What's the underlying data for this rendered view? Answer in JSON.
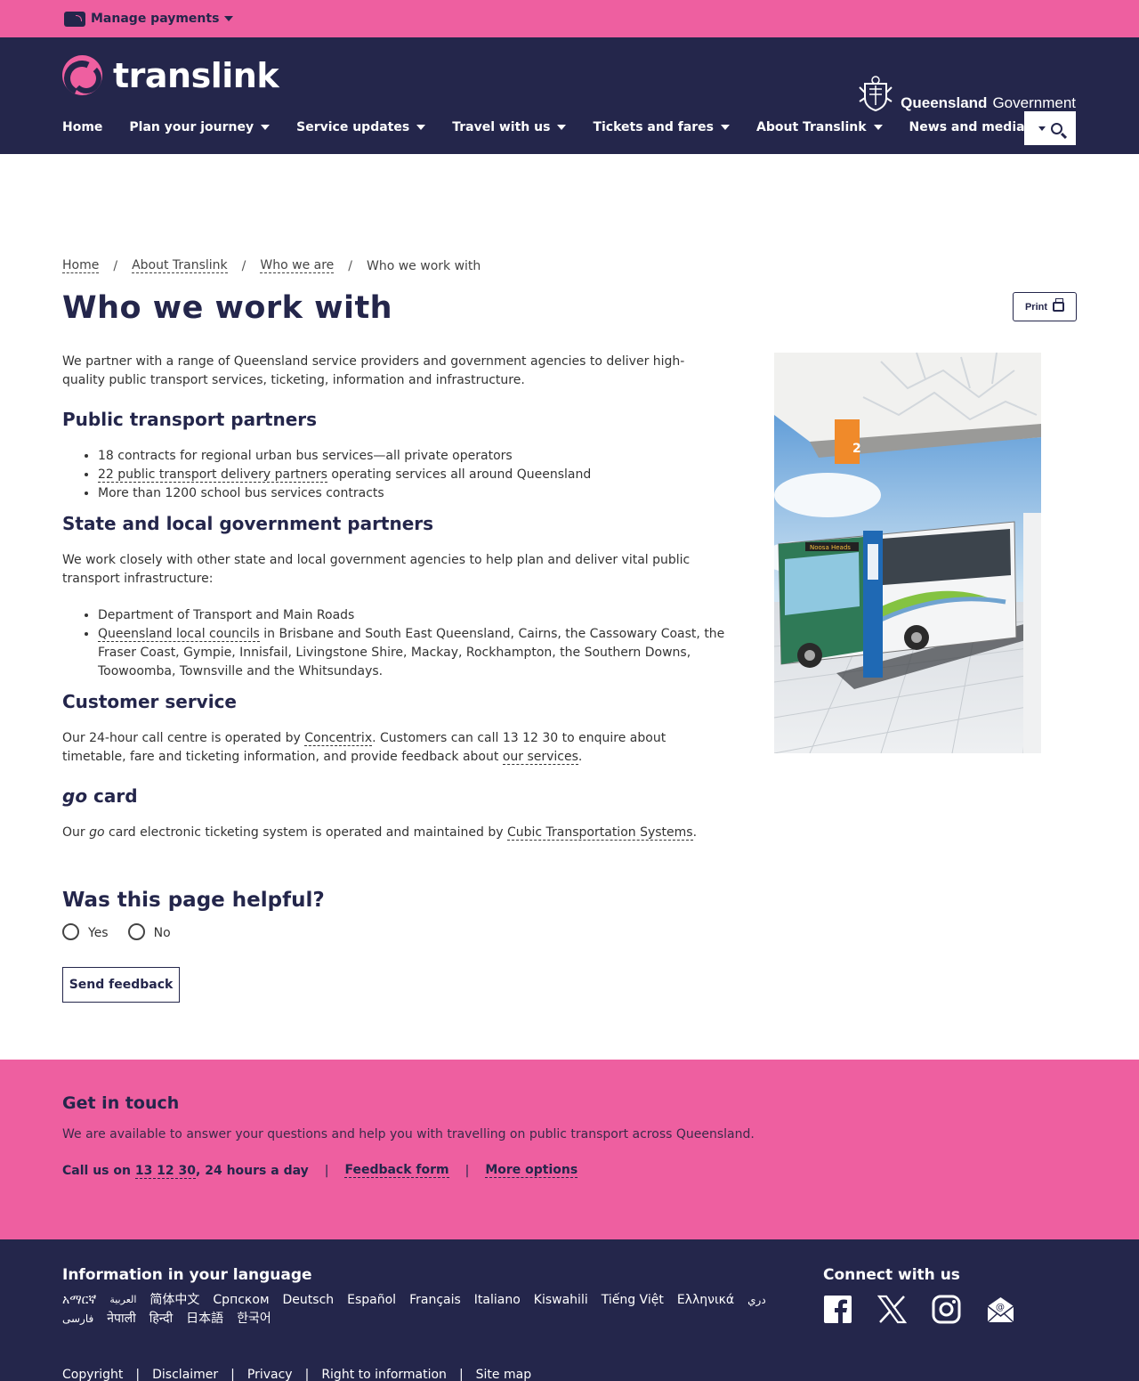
{
  "topbar": {
    "manage_payments": "Manage payments"
  },
  "header": {
    "logo_text": "translink",
    "qg_bold": "Queensland",
    "qg_rest": "Government"
  },
  "nav": [
    {
      "label": "Home",
      "dropdown": false
    },
    {
      "label": "Plan your journey",
      "dropdown": true
    },
    {
      "label": "Service updates",
      "dropdown": true
    },
    {
      "label": "Travel with us",
      "dropdown": true
    },
    {
      "label": "Tickets and fares",
      "dropdown": true
    },
    {
      "label": "About Translink",
      "dropdown": true
    },
    {
      "label": "News and media",
      "dropdown": true
    }
  ],
  "breadcrumb": [
    "Home",
    "About Translink",
    "Who we are",
    "Who we work with"
  ],
  "page": {
    "title": "Who we work with",
    "print": "Print",
    "intro": "We partner with a range of Queensland service providers and government agencies to deliver high-quality public transport services, ticketing, information and infrastructure.",
    "h_public": "Public transport partners",
    "public_items": {
      "i1": "18 contracts for regional urban bus services—all private operators",
      "i2_link": "22 public transport delivery partners",
      "i2_rest": " operating services all around Queensland",
      "i3": "More than 1200 school bus services contracts"
    },
    "h_state": "State and local government partners",
    "state_intro": "We work closely with other state and local government agencies to help plan and deliver vital public transport infrastructure:",
    "state_items": {
      "i1": "Department of Transport and Main Roads",
      "i2_link": "Queensland local councils",
      "i2_rest": " in Brisbane and South East Queensland, Cairns, the Cassowary Coast, the Fraser Coast, Gympie, Innisfail, Livingstone Shire, Mackay, Rockhampton, the Southern Downs, Toowoomba, Townsville and the Whitsundays."
    },
    "h_customer": "Customer service",
    "customer": {
      "pre": "Our 24-hour call centre is operated by ",
      "link1": "Concentrix",
      "mid": ". Customers can call 13 12 30 to enquire about timetable, fare and ticketing information, and provide feedback about ",
      "link2": "our services",
      "post": "."
    },
    "h_go_italic": "go",
    "h_go_rest": " card",
    "go": {
      "pre": "Our ",
      "italic": "go",
      "mid": " card electronic ticketing system is operated and maintained by ",
      "link": "Cubic Transportation Systems",
      "post": "."
    }
  },
  "helpful": {
    "title": "Was this page helpful?",
    "yes": "Yes",
    "no": "No",
    "send": "Send feedback"
  },
  "touch": {
    "title": "Get in touch",
    "text": "We are available to answer your questions and help you with travelling on public transport across Queensland.",
    "call_pre": "Call us on ",
    "call_num": "13 12 30",
    "call_post": ", 24 hours a day",
    "sep": "|",
    "feedback": "Feedback form",
    "more": "More options"
  },
  "footer": {
    "lang_title": "Information in your language",
    "languages": [
      "አማርኛ",
      "العربية",
      "简体中文",
      "Српском",
      "Deutsch",
      "Español",
      "Français",
      "Italiano",
      "Kiswahili",
      "Tiếng Việt",
      "Ελληνικά",
      "دري",
      "فارسی",
      "नेपाली",
      "हिन्दी",
      "日本語",
      "한국어"
    ],
    "connect_title": "Connect with us",
    "socials": [
      "facebook-icon",
      "x-icon",
      "instagram-icon",
      "email-icon"
    ],
    "legal": [
      "Copyright",
      "|",
      "Disclaimer",
      "|",
      "Privacy",
      "|",
      "Right to information",
      "|",
      "Site map"
    ]
  },
  "colors": {
    "pink": "#ee5fa0",
    "navy": "#24264b"
  }
}
